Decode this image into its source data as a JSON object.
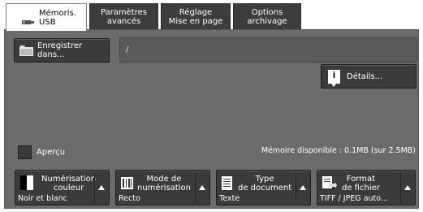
{
  "tabs": [
    {
      "line1": "Mémoris.",
      "line2": "USB"
    },
    {
      "line1": "Paramètres",
      "line2": "avancés"
    },
    {
      "line1": "Réglage",
      "line2": "Mise en page"
    },
    {
      "line1": "Options",
      "line2": "archivage"
    }
  ],
  "save_button": {
    "line1": "Enregistrer",
    "line2": "dans..."
  },
  "path_value": "/",
  "details_button": "Détails...",
  "preview_label": "Aperçu",
  "memory_text": "Mémoire disponible : 0.1MB (sur 2.5MB)",
  "features": [
    {
      "title1": "Numérisation",
      "title2": "couleur",
      "value": "Noir et blanc",
      "icon": "color-scan-icon"
    },
    {
      "title1": "Mode de",
      "title2": "numérisation",
      "value": "Recto",
      "icon": "scan-mode-icon"
    },
    {
      "title1": "Type",
      "title2": "de document",
      "value": "Texte",
      "icon": "document-type-icon"
    },
    {
      "title1": "Format",
      "title2": "de fichier",
      "value": "TIFF / JPEG auto...",
      "icon": "file-format-icon"
    }
  ],
  "colors": {
    "panel": "#6b6b6b",
    "button": "#3b3b3b",
    "active_tab": "#ffffff"
  }
}
